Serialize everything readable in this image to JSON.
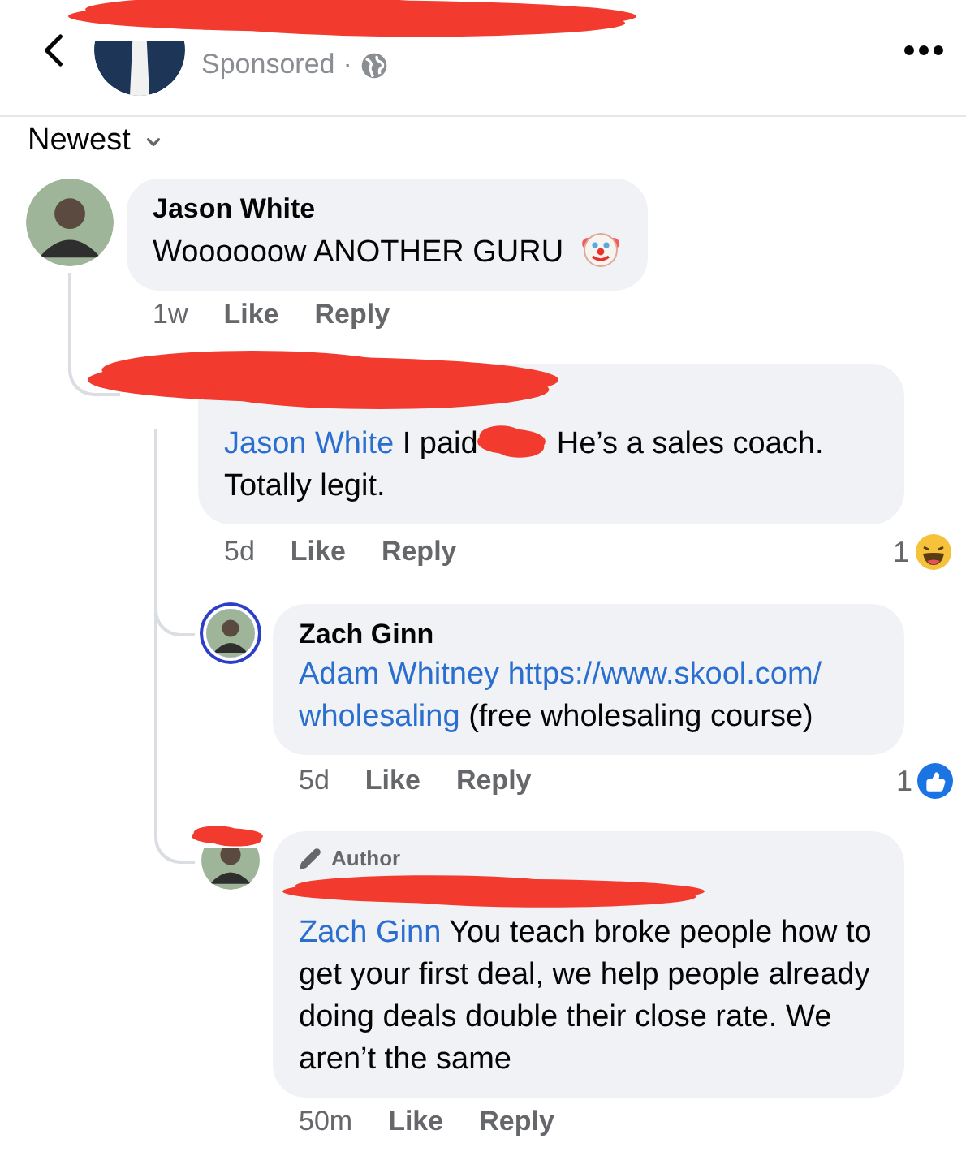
{
  "header": {
    "title_redacted": true,
    "subtitle": "Sponsored",
    "separator": "·"
  },
  "sort": {
    "label": "Newest"
  },
  "comments": [
    {
      "author": "Jason White",
      "body": [
        {
          "kind": "text",
          "text": "Woooooow ANOTHER GURU"
        },
        {
          "kind": "clown"
        }
      ],
      "time": "1w",
      "actions": [
        "Like",
        "Reply"
      ],
      "children": [
        {
          "redacted_header": true,
          "body": [
            {
              "kind": "mention",
              "text": "Jason White"
            },
            {
              "kind": "text",
              "text": "I paid"
            },
            {
              "kind": "redacted"
            },
            {
              "kind": "text",
              "text": "He’s a sales coach. Totally legit."
            }
          ],
          "time": "5d",
          "actions": [
            "Like",
            "Reply"
          ],
          "reaction": {
            "count": "1",
            "kind": "haha"
          },
          "children": [
            {
              "author": "Zach Ginn",
              "ring": true,
              "body": [
                {
                  "kind": "mention",
                  "text": "Adam Whitney"
                },
                {
                  "kind": "link",
                  "text": "https://www.skool.com/"
                },
                {
                  "kind": "link",
                  "text": "wholesaling"
                },
                {
                  "kind": "text",
                  "text": "(free wholesaling course)"
                }
              ],
              "time": "5d",
              "actions": [
                "Like",
                "Reply"
              ],
              "reaction": {
                "count": "1",
                "kind": "like"
              }
            },
            {
              "badge": "Author",
              "name_redacted": true,
              "avatar_redacted": true,
              "body": [
                {
                  "kind": "mention",
                  "text": "Zach Ginn"
                },
                {
                  "kind": "text",
                  "text": "You teach broke people how to get your first deal, we help people already doing deals double their close rate. We aren’t the same"
                }
              ],
              "time": "50m",
              "actions": [
                "Like",
                "Reply"
              ]
            }
          ]
        }
      ]
    }
  ]
}
